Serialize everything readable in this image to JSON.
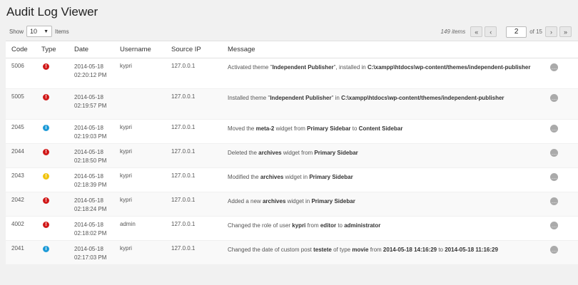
{
  "page": {
    "title": "Audit Log Viewer"
  },
  "controls": {
    "show_label": "Show",
    "per_page": "10",
    "items_label": "Items",
    "total": "149 items",
    "first_icon": "«",
    "prev_icon": "‹",
    "current_page": "2",
    "of_label": "of 15",
    "next_icon": "›",
    "last_icon": "»"
  },
  "colors": {
    "error": "#d11a1a",
    "info": "#1e9bd7",
    "warning": "#f1c40f"
  },
  "columns": [
    "Code",
    "Type",
    "Date",
    "Username",
    "Source IP",
    "Message"
  ],
  "rows": [
    {
      "code": "5006",
      "type": "error",
      "type_icon": "!",
      "date": "2014-05-18",
      "time": "02:20:12 PM",
      "user": "kypri",
      "ip": "127.0.0.1",
      "message": [
        {
          "t": "Activated theme \"",
          "b": false
        },
        {
          "t": "Independent Publisher",
          "b": true
        },
        {
          "t": "\", installed in ",
          "b": false
        },
        {
          "t": "C:\\xampp\\htdocs\\wp-content/themes/independent-publisher",
          "b": true
        }
      ]
    },
    {
      "code": "5005",
      "type": "error",
      "type_icon": "!",
      "date": "2014-05-18",
      "time": "02:19:57 PM",
      "user": "",
      "ip": "127.0.0.1",
      "message": [
        {
          "t": "Installed theme \"",
          "b": false
        },
        {
          "t": "Independent Publisher",
          "b": true
        },
        {
          "t": "\" in ",
          "b": false
        },
        {
          "t": "C:\\xampp\\htdocs\\wp-content/themes/independent-publisher",
          "b": true
        }
      ]
    },
    {
      "code": "2045",
      "type": "info",
      "type_icon": "i",
      "date": "2014-05-18",
      "time": "02:19:03 PM",
      "user": "kypri",
      "ip": "127.0.0.1",
      "message": [
        {
          "t": "Moved the ",
          "b": false
        },
        {
          "t": "meta-2",
          "b": true
        },
        {
          "t": " widget from ",
          "b": false
        },
        {
          "t": "Primary Sidebar",
          "b": true
        },
        {
          "t": " to ",
          "b": false
        },
        {
          "t": "Content Sidebar",
          "b": true
        }
      ]
    },
    {
      "code": "2044",
      "type": "error",
      "type_icon": "!",
      "date": "2014-05-18",
      "time": "02:18:50 PM",
      "user": "kypri",
      "ip": "127.0.0.1",
      "message": [
        {
          "t": "Deleted the ",
          "b": false
        },
        {
          "t": "archives",
          "b": true
        },
        {
          "t": " widget from ",
          "b": false
        },
        {
          "t": "Primary Sidebar",
          "b": true
        }
      ]
    },
    {
      "code": "2043",
      "type": "warning",
      "type_icon": "!",
      "date": "2014-05-18",
      "time": "02:18:39 PM",
      "user": "kypri",
      "ip": "127.0.0.1",
      "message": [
        {
          "t": "Modified the ",
          "b": false
        },
        {
          "t": "archives",
          "b": true
        },
        {
          "t": " widget in ",
          "b": false
        },
        {
          "t": "Primary Sidebar",
          "b": true
        }
      ]
    },
    {
      "code": "2042",
      "type": "error",
      "type_icon": "!",
      "date": "2014-05-18",
      "time": "02:18:24 PM",
      "user": "kypri",
      "ip": "127.0.0.1",
      "message": [
        {
          "t": "Added a new ",
          "b": false
        },
        {
          "t": "archives",
          "b": true
        },
        {
          "t": " widget in ",
          "b": false
        },
        {
          "t": "Primary Sidebar",
          "b": true
        }
      ]
    },
    {
      "code": "4002",
      "type": "error",
      "type_icon": "!",
      "date": "2014-05-18",
      "time": "02:18:02 PM",
      "user": "admin",
      "ip": "127.0.0.1",
      "message": [
        {
          "t": "Changed the role of user ",
          "b": false
        },
        {
          "t": "kypri",
          "b": true
        },
        {
          "t": " from ",
          "b": false
        },
        {
          "t": "editor",
          "b": true
        },
        {
          "t": " to ",
          "b": false
        },
        {
          "t": "administrator",
          "b": true
        }
      ]
    },
    {
      "code": "2041",
      "type": "info",
      "type_icon": "i",
      "date": "2014-05-18",
      "time": "02:17:03 PM",
      "user": "kypri",
      "ip": "127.0.0.1",
      "message": [
        {
          "t": "Changed the date of custom post ",
          "b": false
        },
        {
          "t": "testete",
          "b": true
        },
        {
          "t": " of type ",
          "b": false
        },
        {
          "t": "movie",
          "b": true
        },
        {
          "t": " from ",
          "b": false
        },
        {
          "t": "2014-05-18 14:16:29",
          "b": true
        },
        {
          "t": " to ",
          "b": false
        },
        {
          "t": "2014-05-18 11:16:29",
          "b": true
        }
      ]
    }
  ],
  "row_action_icon": "…"
}
